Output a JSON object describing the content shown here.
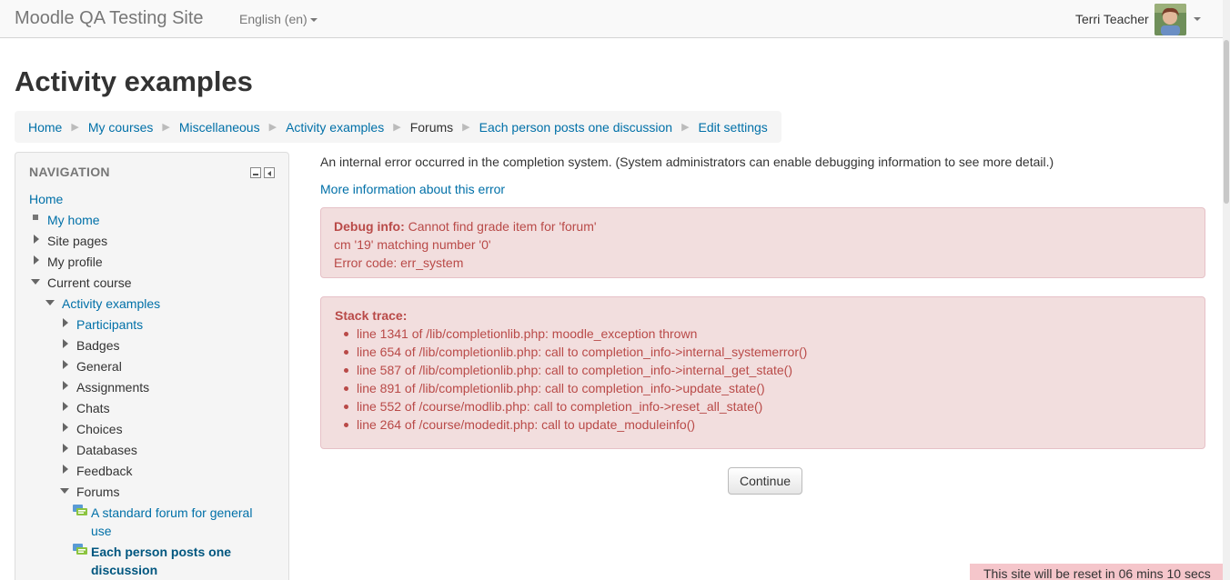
{
  "navbar": {
    "brand": "Moodle QA Testing Site",
    "language": "English (en)",
    "user_name": "Terri Teacher"
  },
  "page": {
    "title": "Activity examples"
  },
  "breadcrumb": [
    {
      "label": "Home",
      "link": true
    },
    {
      "label": "My courses",
      "link": true
    },
    {
      "label": "Miscellaneous",
      "link": true
    },
    {
      "label": "Activity examples",
      "link": true
    },
    {
      "label": "Forums",
      "link": false
    },
    {
      "label": "Each person posts one discussion",
      "link": true
    },
    {
      "label": "Edit settings",
      "link": true
    }
  ],
  "navigation": {
    "header": "NAVIGATION",
    "items": [
      {
        "label": "Home"
      },
      {
        "label": "My home"
      },
      {
        "label": "Site pages"
      },
      {
        "label": "My profile"
      },
      {
        "label": "Current course"
      },
      {
        "label": "Activity examples"
      },
      {
        "label": "Participants"
      },
      {
        "label": "Badges"
      },
      {
        "label": "General"
      },
      {
        "label": "Assignments"
      },
      {
        "label": "Chats"
      },
      {
        "label": "Choices"
      },
      {
        "label": "Databases"
      },
      {
        "label": "Feedback"
      },
      {
        "label": "Forums"
      },
      {
        "label_line1": "A standard forum for general",
        "label_line2": "use"
      },
      {
        "label_line1": "Each person posts one",
        "label_line2": "discussion"
      }
    ]
  },
  "main": {
    "error_message": "An internal error occurred in the completion system. (System administrators can enable debugging information to see more detail.)",
    "more_info_link": "More information about this error",
    "debug": {
      "label": "Debug info:",
      "line1": "Cannot find grade item for 'forum'",
      "line2": "cm '19' matching number '0'",
      "line3": "Error code: err_system"
    },
    "stack": {
      "title": "Stack trace:",
      "lines": [
        "line 1341 of /lib/completionlib.php: moodle_exception thrown",
        "line 654 of /lib/completionlib.php: call to completion_info->internal_systemerror()",
        "line 587 of /lib/completionlib.php: call to completion_info->internal_get_state()",
        "line 891 of /lib/completionlib.php: call to completion_info->update_state()",
        "line 552 of /course/modlib.php: call to completion_info->reset_all_state()",
        "line 264 of /course/modedit.php: call to update_moduleinfo()"
      ]
    },
    "continue_label": "Continue"
  },
  "reset_notice": "This site will be reset in 06 mins 10 secs",
  "colors": {
    "link": "#0070a8",
    "alert_bg": "#f2dede",
    "alert_text": "#b94a48"
  }
}
